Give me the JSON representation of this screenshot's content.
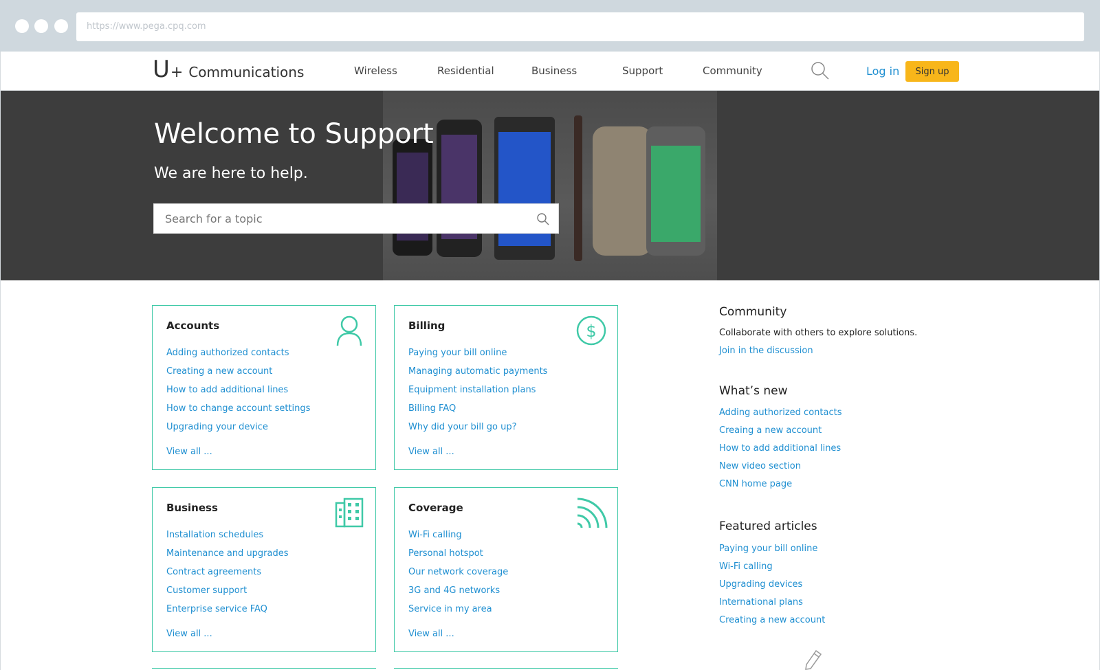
{
  "browser": {
    "url": "https://www.pega.cpq.com"
  },
  "nav": {
    "logo_u": "U",
    "logo_plus": "+",
    "logo_text": "Communications",
    "links": [
      "Wireless",
      "Residential",
      "Business",
      "Support",
      "Community"
    ],
    "login": "Log in",
    "signup": "Sign up"
  },
  "hero": {
    "title": "Welcome to Support",
    "subtitle": "We are here to help.",
    "search_placeholder": "Search for a topic"
  },
  "cards": [
    {
      "title": "Accounts",
      "icon": "user-icon",
      "links": [
        "Adding authorized contacts",
        "Creating a new account",
        "How to add additional lines",
        "How to change account settings",
        "Upgrading your device"
      ],
      "view_all": "View all ..."
    },
    {
      "title": "Billing",
      "icon": "dollar-icon",
      "links": [
        "Paying your bill online",
        "Managing automatic payments",
        "Equipment installation plans",
        "Billing FAQ",
        "Why did your bill go up?"
      ],
      "view_all": "View all ..."
    },
    {
      "title": "Business",
      "icon": "building-icon",
      "links": [
        "Installation schedules",
        "Maintenance and upgrades",
        "Contract agreements",
        "Customer support",
        "Enterprise service FAQ"
      ],
      "view_all": "View all ..."
    },
    {
      "title": "Coverage",
      "icon": "signal-icon",
      "links": [
        "Wi-Fi calling",
        "Personal hotspot",
        "Our network coverage",
        "3G and 4G networks",
        "Service in my area"
      ],
      "view_all": "View all ..."
    }
  ],
  "sidebar": {
    "community": {
      "title": "Community",
      "text": "Collaborate with others to explore solutions.",
      "link": "Join in the discussion"
    },
    "whats_new": {
      "title": "What’s new",
      "links": [
        "Adding authorized contacts",
        "Creaing a new account",
        "How to add additional lines",
        "New video section",
        "CNN home page"
      ]
    },
    "featured": {
      "title": "Featured articles",
      "links": [
        "Paying your bill online",
        "Wi-Fi calling",
        "Upgrading devices",
        "International plans",
        "Creating a new account"
      ]
    }
  },
  "colors": {
    "accent": "#3fc9a7",
    "link": "#1f8fd1",
    "signup": "#f8b61a",
    "hero_bg": "#3d3d3d"
  }
}
